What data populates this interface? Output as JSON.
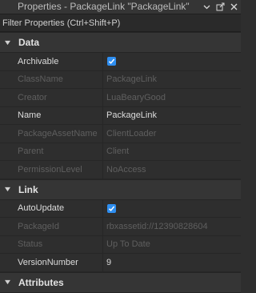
{
  "window": {
    "title": "Properties - PackageLink \"PackageLink\"",
    "dropdown_icon": "chevron-down-icon",
    "popout_icon": "popout-icon",
    "close_icon": "close-icon"
  },
  "filter": {
    "placeholder": "Filter Properties (Ctrl+Shift+P)"
  },
  "sections": {
    "data": {
      "label": "Data",
      "rows": [
        {
          "name": "Archivable",
          "value": "",
          "checked": true
        },
        {
          "name": "ClassName",
          "value": "PackageLink"
        },
        {
          "name": "Creator",
          "value": "LuaBearyGood"
        },
        {
          "name": "Name",
          "value": "PackageLink"
        },
        {
          "name": "PackageAssetName",
          "value": "ClientLoader"
        },
        {
          "name": "Parent",
          "value": "Client"
        },
        {
          "name": "PermissionLevel",
          "value": "NoAccess"
        }
      ]
    },
    "link": {
      "label": "Link",
      "rows": [
        {
          "name": "AutoUpdate",
          "value": "",
          "checked": true
        },
        {
          "name": "PackageId",
          "value": "rbxassetid://12390828604"
        },
        {
          "name": "Status",
          "value": "Up To Date"
        },
        {
          "name": "VersionNumber",
          "value": "9"
        }
      ]
    },
    "attributes": {
      "label": "Attributes"
    }
  },
  "colors": {
    "accent": "#2e8ef0",
    "background": "#2e2e2e",
    "readonly_text": "#5f5f5f"
  }
}
